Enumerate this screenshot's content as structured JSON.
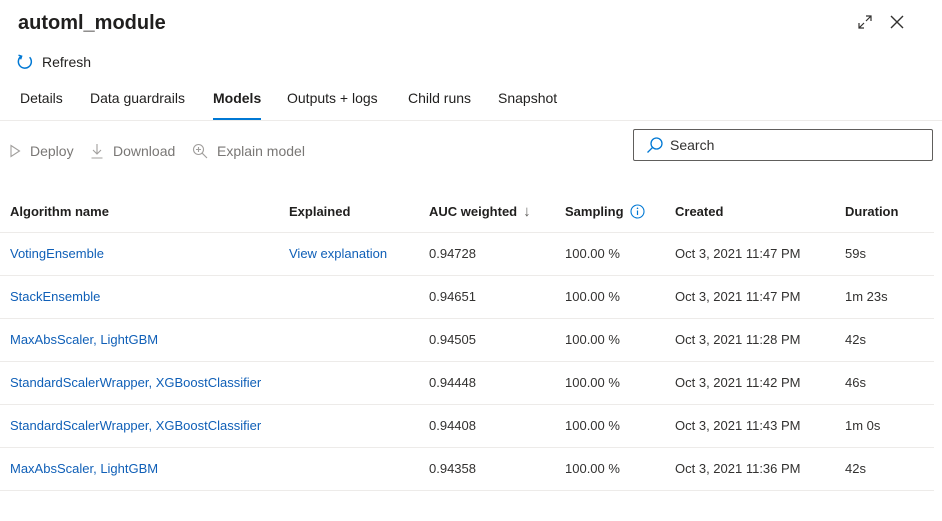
{
  "window": {
    "title": "automl_module",
    "expand_icon": "expand-icon",
    "close_icon": "close-icon"
  },
  "actions": {
    "refresh_label": "Refresh",
    "refresh_icon": "refresh-icon"
  },
  "tabs": [
    {
      "label": "Details",
      "active": false
    },
    {
      "label": "Data guardrails",
      "active": false
    },
    {
      "label": "Models",
      "active": true
    },
    {
      "label": "Outputs + logs",
      "active": false
    },
    {
      "label": "Child runs",
      "active": false
    },
    {
      "label": "Snapshot",
      "active": false
    }
  ],
  "toolbar": {
    "deploy_label": "Deploy",
    "download_label": "Download",
    "explain_label": "Explain model"
  },
  "search": {
    "placeholder": "Search"
  },
  "table": {
    "headers": {
      "algorithm": "Algorithm name",
      "explained": "Explained",
      "auc": "AUC weighted",
      "sampling": "Sampling",
      "created": "Created",
      "duration": "Duration"
    },
    "sort_indicator": "↓",
    "rows": [
      {
        "algorithm": "VotingEnsemble",
        "explained": "View explanation",
        "auc": "0.94728",
        "sampling": "100.00 %",
        "created": "Oct 3, 2021 11:47 PM",
        "duration": "59s"
      },
      {
        "algorithm": "StackEnsemble",
        "explained": "",
        "auc": "0.94651",
        "sampling": "100.00 %",
        "created": "Oct 3, 2021 11:47 PM",
        "duration": "1m 23s"
      },
      {
        "algorithm": "MaxAbsScaler, LightGBM",
        "explained": "",
        "auc": "0.94505",
        "sampling": "100.00 %",
        "created": "Oct 3, 2021 11:28 PM",
        "duration": "42s"
      },
      {
        "algorithm": "StandardScalerWrapper, XGBoostClassifier",
        "explained": "",
        "auc": "0.94448",
        "sampling": "100.00 %",
        "created": "Oct 3, 2021 11:42 PM",
        "duration": "46s"
      },
      {
        "algorithm": "StandardScalerWrapper, XGBoostClassifier",
        "explained": "",
        "auc": "0.94408",
        "sampling": "100.00 %",
        "created": "Oct 3, 2021 11:43 PM",
        "duration": "1m 0s"
      },
      {
        "algorithm": "MaxAbsScaler, LightGBM",
        "explained": "",
        "auc": "0.94358",
        "sampling": "100.00 %",
        "created": "Oct 3, 2021 11:36 PM",
        "duration": "42s"
      }
    ]
  },
  "colors": {
    "accent": "#0078d4",
    "link": "#0f5fb7",
    "disabled": "#797775"
  }
}
